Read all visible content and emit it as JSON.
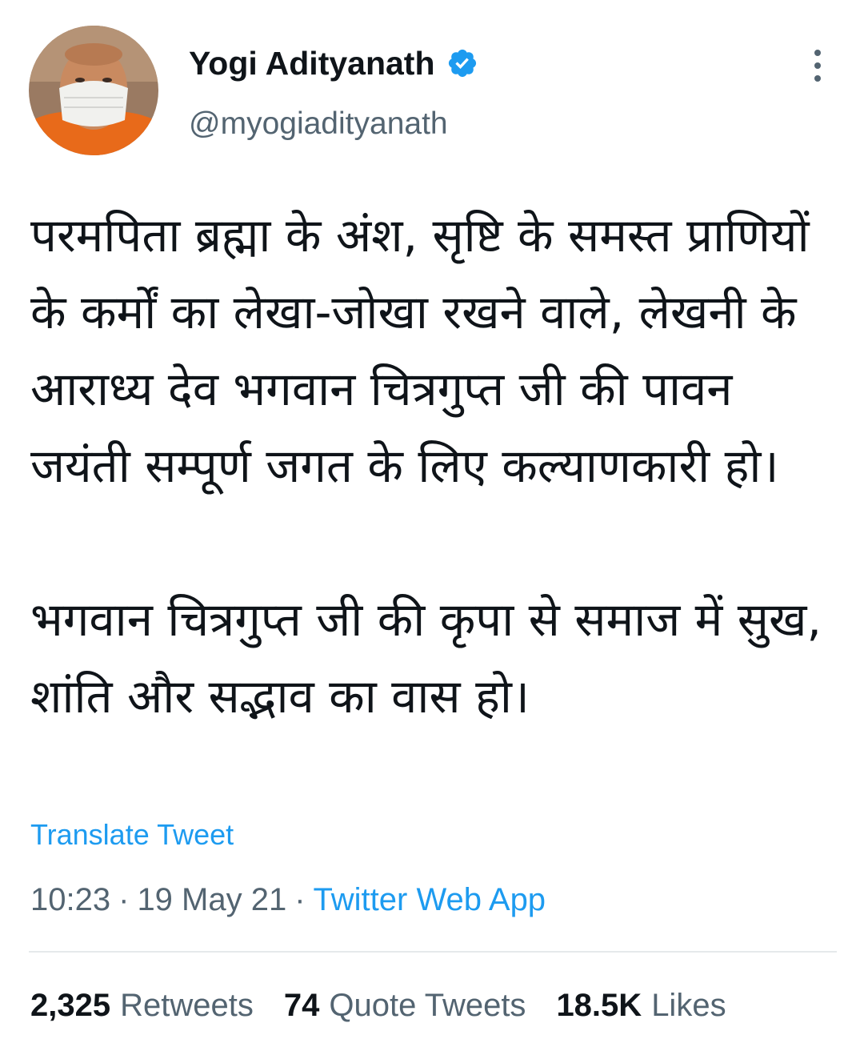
{
  "colors": {
    "text": "#0f1419",
    "secondary": "#536471",
    "link": "#1d9bf0",
    "divider": "#e5e9eb"
  },
  "header": {
    "display_name": "Yogi Adityanath",
    "handle": "@myogiadityanath",
    "verified_icon": "verified-badge-icon",
    "more_icon": "more-vertical-icon"
  },
  "tweet": {
    "paragraphs": [
      "परमपिता ब्रह्मा के अंश, सृष्टि के समस्त प्राणियों के कर्मों का लेखा-जोखा रखने वाले, लेखनी के आराध्य देव भगवान चित्रगुप्त जी की पावन जयंती सम्पूर्ण जगत के लिए कल्याणकारी हो।",
      "भगवान चित्रगुप्त जी की कृपा से समाज में सुख, शांति और सद्भाव का वास हो।"
    ],
    "translate_label": "Translate Tweet",
    "time": "10:23",
    "date": "19 May 21",
    "source": "Twitter Web App",
    "separator": "·"
  },
  "stats": {
    "retweets_count": "2,325",
    "retweets_label": "Retweets",
    "quotes_count": "74",
    "quotes_label": "Quote Tweets",
    "likes_count": "18.5K",
    "likes_label": "Likes"
  }
}
